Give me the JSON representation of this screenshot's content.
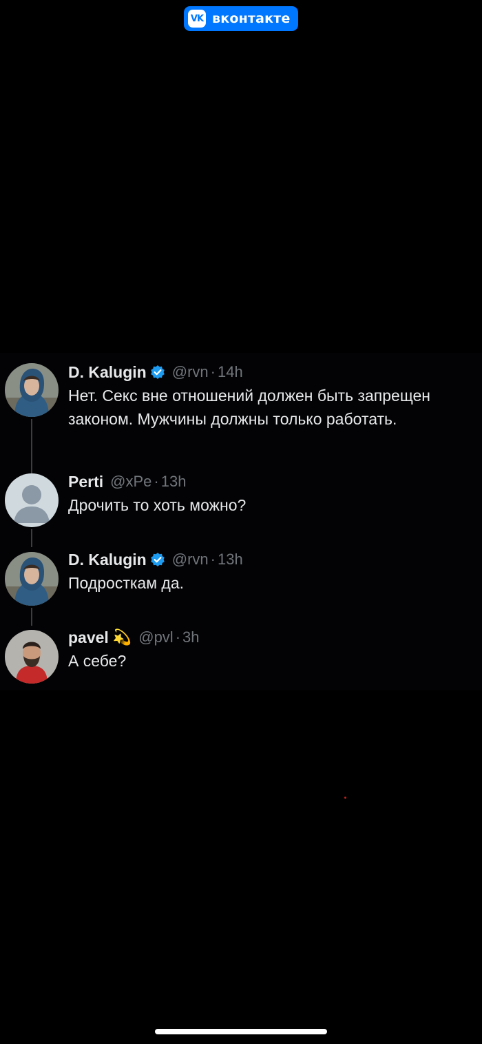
{
  "badge": {
    "logo": "VK",
    "label": "вконтакте",
    "color": "#0077ff"
  },
  "tweets": [
    {
      "name": "D. Kalugin",
      "verified": true,
      "handle": "@rvn",
      "separator": "·",
      "time": "14h",
      "text": "Нет. Секс вне отношений должен быть запрещен законом. Мужчины должны только работать.",
      "avatar": "person-hood-avatar"
    },
    {
      "name": "Perti",
      "verified": false,
      "handle": "@xPe",
      "separator": "·",
      "time": "13h",
      "text": "Дрочить то хоть можно?",
      "avatar": "default-avatar"
    },
    {
      "name": "D. Kalugin",
      "verified": true,
      "handle": "@rvn",
      "separator": "·",
      "time": "13h",
      "text": "Подросткам да.",
      "avatar": "person-hood-avatar"
    },
    {
      "name": "pavel",
      "verified": false,
      "emoji": "💫",
      "handle": "@pvl",
      "separator": "·",
      "time": "3h",
      "text": "А себе?",
      "avatar": "person-beard-avatar"
    }
  ],
  "colors": {
    "background": "#000000",
    "text": "#e7e9ea",
    "muted": "#71767b",
    "verified": "#1d9bf0"
  }
}
